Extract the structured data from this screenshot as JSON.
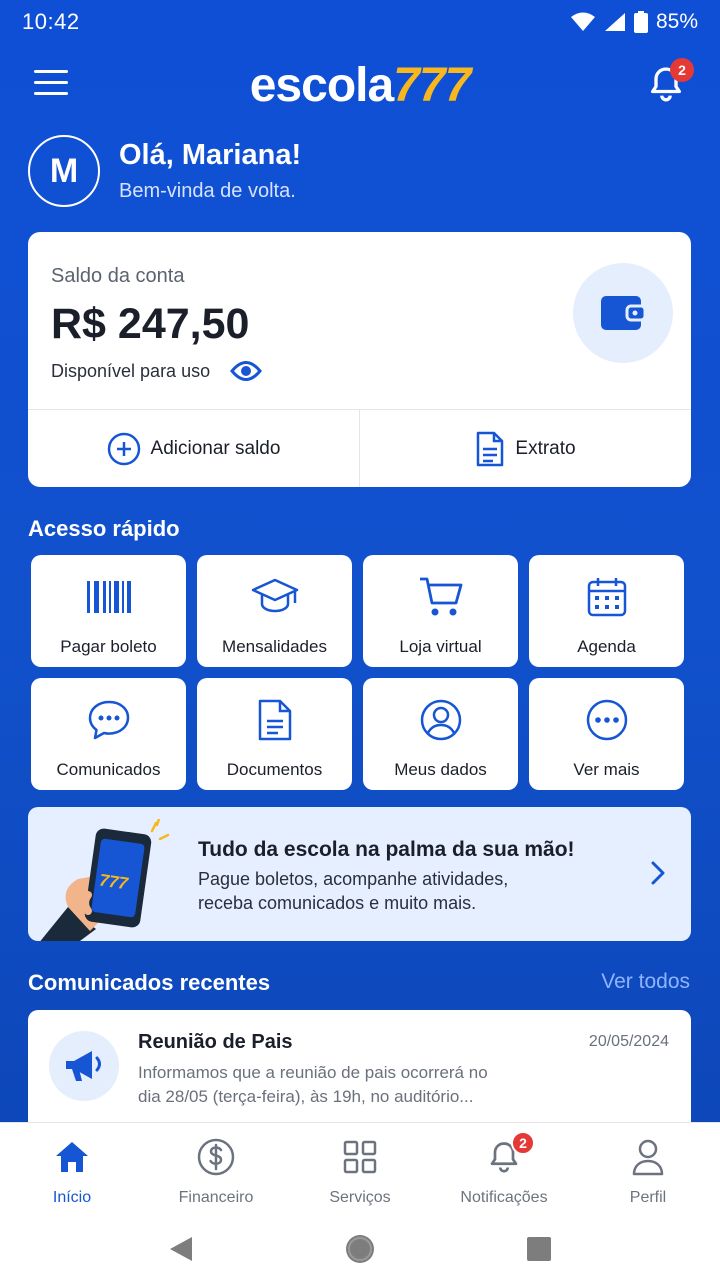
{
  "status_bar": {
    "time": "10:42",
    "battery": "85%"
  },
  "header": {
    "logo_text": "escola",
    "logo_number": "777",
    "notification_count": "2"
  },
  "greeting": {
    "avatar_initial": "M",
    "title": "Olá, Mariana!",
    "subtitle": "Bem-vinda de volta."
  },
  "balance": {
    "label": "Saldo da conta",
    "value": "R$ 247,50",
    "available_label": "Disponível para uso",
    "add_label": "Adicionar saldo",
    "statement_label": "Extrato"
  },
  "quick_access": {
    "title": "Acesso rápido",
    "items": [
      {
        "label": "Pagar boleto",
        "icon": "barcode-icon"
      },
      {
        "label": "Mensalidades",
        "icon": "graduation-cap-icon"
      },
      {
        "label": "Loja virtual",
        "icon": "cart-icon"
      },
      {
        "label": "Agenda",
        "icon": "calendar-icon"
      },
      {
        "label": "Comunicados",
        "icon": "chat-icon"
      },
      {
        "label": "Documentos",
        "icon": "document-icon"
      },
      {
        "label": "Meus dados",
        "icon": "user-circle-icon"
      },
      {
        "label": "Ver mais",
        "icon": "more-icon"
      }
    ]
  },
  "promo": {
    "phone_text": "777",
    "title": "Tudo da escola na palma da sua mão!",
    "line1": "Pague boletos, acompanhe atividades,",
    "line2": "receba comunicados e muito mais."
  },
  "recent": {
    "title": "Comunicados recentes",
    "see_all": "Ver todos",
    "items": [
      {
        "title": "Reunião de Pais",
        "date": "20/05/2024",
        "line1": "Informamos que a reunião de pais ocorrerá no",
        "line2": "dia 28/05 (terça-feira), às 19h, no auditório..."
      }
    ]
  },
  "bottom_nav": {
    "items": [
      {
        "label": "Início",
        "icon": "home-icon",
        "active": true
      },
      {
        "label": "Financeiro",
        "icon": "dollar-icon"
      },
      {
        "label": "Serviços",
        "icon": "grid-icon"
      },
      {
        "label": "Notificações",
        "icon": "bell-icon",
        "badge": "2"
      },
      {
        "label": "Perfil",
        "icon": "person-icon"
      }
    ]
  },
  "colors": {
    "primary": "#1253CF",
    "accent": "#F7B71D",
    "badge": "#E53935",
    "link": "#8FB4FF"
  }
}
